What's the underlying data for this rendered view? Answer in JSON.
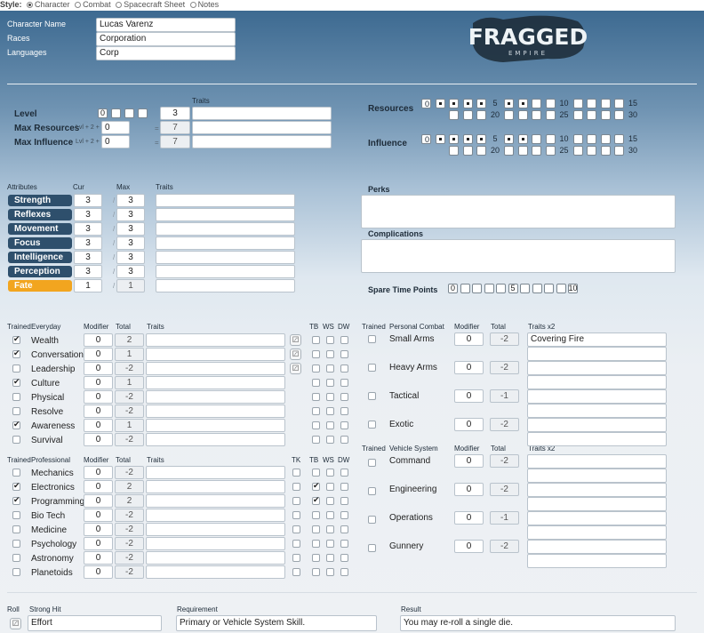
{
  "style_bar": {
    "label": "Style:",
    "options": [
      "Character",
      "Combat",
      "Spacecraft Sheet",
      "Notes"
    ],
    "selected": "Character"
  },
  "identity": {
    "labels": {
      "name": "Character Name",
      "races": "Races",
      "languages": "Languages"
    },
    "values": {
      "name": "Lucas Varenz",
      "races": "Corporation",
      "languages": "Corp"
    }
  },
  "logo": {
    "text": "FRAGGED",
    "sub": "EMPIRE"
  },
  "level_block": {
    "traits_header": "Traits",
    "level": {
      "label": "Level",
      "boxes": [
        "0",
        "",
        "",
        ""
      ],
      "value": "3"
    },
    "max_resources": {
      "label": "Max Resources",
      "formula": "Lvl + 2 +",
      "bonus": "0",
      "equals": "=",
      "value": "7"
    },
    "max_influence": {
      "label": "Max Influence",
      "formula": "Lvl + 2 +",
      "bonus": "0",
      "equals": "=",
      "value": "7"
    }
  },
  "tracks": {
    "resources": {
      "label": "Resources",
      "row1_labels": [
        "0",
        "5",
        "10",
        "15"
      ],
      "row2_labels": [
        "20",
        "25",
        "30"
      ],
      "filled_count": 8
    },
    "influence": {
      "label": "Influence",
      "row1_labels": [
        "0",
        "5",
        "10",
        "15"
      ],
      "row2_labels": [
        "20",
        "25",
        "30"
      ],
      "filled_count": 8
    }
  },
  "attributes": {
    "headers": {
      "attribute": "Attributes",
      "cur": "Cur",
      "max": "Max",
      "traits": "Traits"
    },
    "rows": [
      {
        "name": "Strength",
        "cur": "3",
        "max": "3"
      },
      {
        "name": "Reflexes",
        "cur": "3",
        "max": "3"
      },
      {
        "name": "Movement",
        "cur": "3",
        "max": "3"
      },
      {
        "name": "Focus",
        "cur": "3",
        "max": "3"
      },
      {
        "name": "Intelligence",
        "cur": "3",
        "max": "3"
      },
      {
        "name": "Perception",
        "cur": "3",
        "max": "3"
      },
      {
        "name": "Fate",
        "cur": "1",
        "max": "1"
      }
    ]
  },
  "perks": {
    "label": "Perks"
  },
  "complications": {
    "label": "Complications"
  },
  "spare_time": {
    "label": "Spare Time Points",
    "labels": [
      "0",
      "5",
      "10"
    ]
  },
  "everyday": {
    "headers": {
      "trained": "Trained",
      "group": "Everyday",
      "modifier": "Modifier",
      "total": "Total",
      "traits": "Traits",
      "tb": "TB",
      "ws": "WS",
      "dw": "DW"
    },
    "rows": [
      {
        "name": "Wealth",
        "trained": true,
        "modifier": "0",
        "total": "2"
      },
      {
        "name": "Conversation",
        "trained": true,
        "modifier": "0",
        "total": "1"
      },
      {
        "name": "Leadership",
        "trained": false,
        "modifier": "0",
        "total": "-2"
      },
      {
        "name": "Culture",
        "trained": true,
        "modifier": "0",
        "total": "1"
      },
      {
        "name": "Physical",
        "trained": false,
        "modifier": "0",
        "total": "-2"
      },
      {
        "name": "Resolve",
        "trained": false,
        "modifier": "0",
        "total": "-2"
      },
      {
        "name": "Awareness",
        "trained": true,
        "modifier": "0",
        "total": "1"
      },
      {
        "name": "Survival",
        "trained": false,
        "modifier": "0",
        "total": "-2"
      }
    ]
  },
  "professional": {
    "headers": {
      "trained": "Trained",
      "group": "Professional",
      "modifier": "Modifier",
      "total": "Total",
      "traits": "Traits",
      "tk": "TK",
      "tb": "TB",
      "ws": "WS",
      "dw": "DW"
    },
    "rows": [
      {
        "name": "Mechanics",
        "trained": false,
        "modifier": "0",
        "total": "-2",
        "tb": false
      },
      {
        "name": "Electronics",
        "trained": true,
        "modifier": "0",
        "total": "2",
        "tb": true
      },
      {
        "name": "Programming",
        "trained": true,
        "modifier": "0",
        "total": "2",
        "tb": true
      },
      {
        "name": "Bio Tech",
        "trained": false,
        "modifier": "0",
        "total": "-2",
        "tb": false
      },
      {
        "name": "Medicine",
        "trained": false,
        "modifier": "0",
        "total": "-2",
        "tb": false
      },
      {
        "name": "Psychology",
        "trained": false,
        "modifier": "0",
        "total": "-2",
        "tb": false
      },
      {
        "name": "Astronomy",
        "trained": false,
        "modifier": "0",
        "total": "-2",
        "tb": false
      },
      {
        "name": "Planetoids",
        "trained": false,
        "modifier": "0",
        "total": "-2",
        "tb": false
      }
    ]
  },
  "personal_combat": {
    "headers": {
      "trained": "Trained",
      "group": "Personal Combat",
      "modifier": "Modifier",
      "total": "Total",
      "traits": "Traits x2"
    },
    "rows": [
      {
        "name": "Small Arms",
        "modifier": "0",
        "total": "-2",
        "trait1": "Covering Fire"
      },
      {
        "name": "Heavy Arms",
        "modifier": "0",
        "total": "-2",
        "trait1": ""
      },
      {
        "name": "Tactical",
        "modifier": "0",
        "total": "-1",
        "trait1": ""
      },
      {
        "name": "Exotic",
        "modifier": "0",
        "total": "-2",
        "trait1": ""
      }
    ]
  },
  "vehicle_system": {
    "headers": {
      "trained": "Trained",
      "group": "Vehicle System",
      "modifier": "Modifier",
      "total": "Total",
      "traits": "Traits x2"
    },
    "rows": [
      {
        "name": "Command",
        "modifier": "0",
        "total": "-2"
      },
      {
        "name": "Engineering",
        "modifier": "0",
        "total": "-2"
      },
      {
        "name": "Operations",
        "modifier": "0",
        "total": "-1"
      },
      {
        "name": "Gunnery",
        "modifier": "0",
        "total": "-2"
      }
    ]
  },
  "strong_hit": {
    "headers": {
      "roll": "Roll",
      "strong_hit": "Strong Hit",
      "requirement": "Requirement",
      "result": "Result"
    },
    "value": "Effort",
    "requirement": "Primary or Vehicle System Skill.",
    "result": "You may re-roll a single die."
  }
}
